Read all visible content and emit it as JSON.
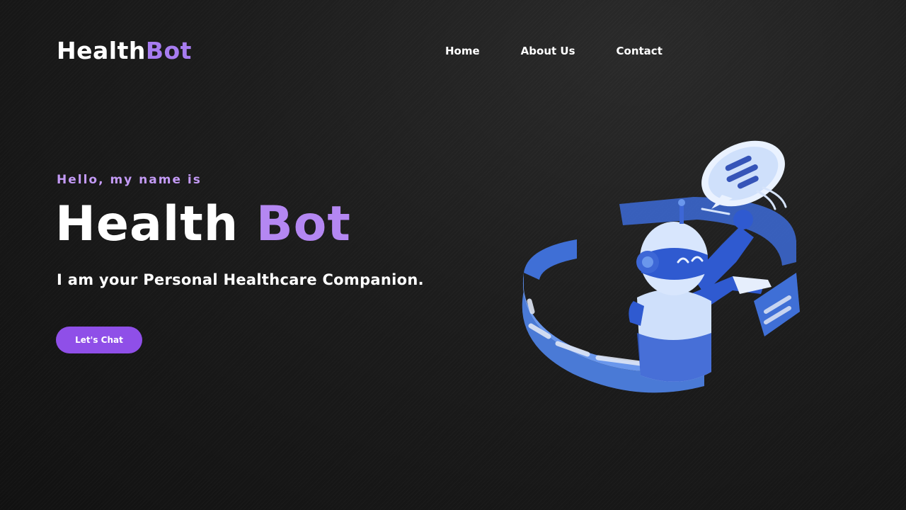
{
  "brand": {
    "name_part1": "Health",
    "name_part2": "Bot"
  },
  "nav": {
    "items": [
      {
        "label": "Home"
      },
      {
        "label": "About Us"
      },
      {
        "label": "Contact"
      }
    ]
  },
  "hero": {
    "greeting": "Hello, my name is",
    "title_part1": "Health",
    "title_part2": "Bot",
    "tagline": "I am your Personal Healthcare Companion.",
    "cta_label": "Let's Chat"
  },
  "colors": {
    "accent": "#b487f2",
    "button": "#8f4fe8",
    "background": "#1a1a1a"
  },
  "icons": {
    "illustration": "robot-illustration",
    "chat_bubble": "chat-bubble-icon"
  }
}
